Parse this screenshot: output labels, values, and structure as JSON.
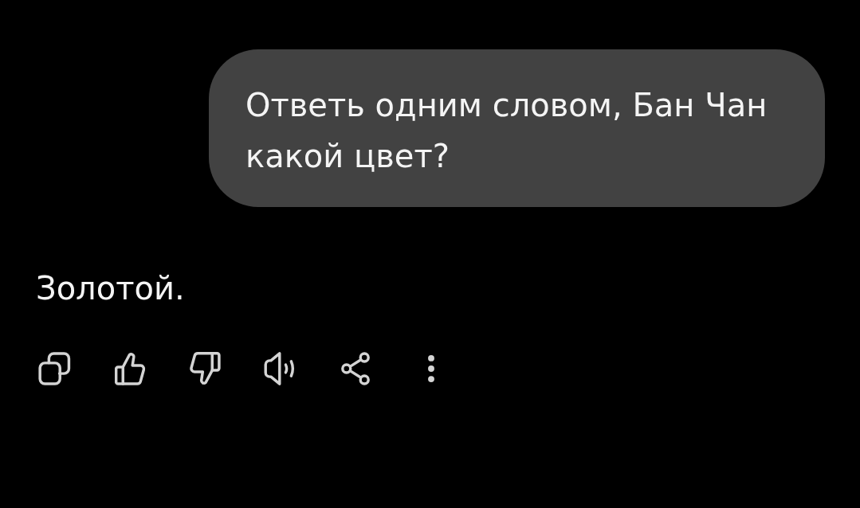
{
  "user_message": {
    "text": "Ответь одним словом, Бан Чан какой цвет?"
  },
  "response": {
    "text": "Золотой."
  },
  "actions": [
    {
      "kind": "copy"
    },
    {
      "kind": "like"
    },
    {
      "kind": "dislike"
    },
    {
      "kind": "read_aloud"
    },
    {
      "kind": "share"
    },
    {
      "kind": "more"
    }
  ]
}
